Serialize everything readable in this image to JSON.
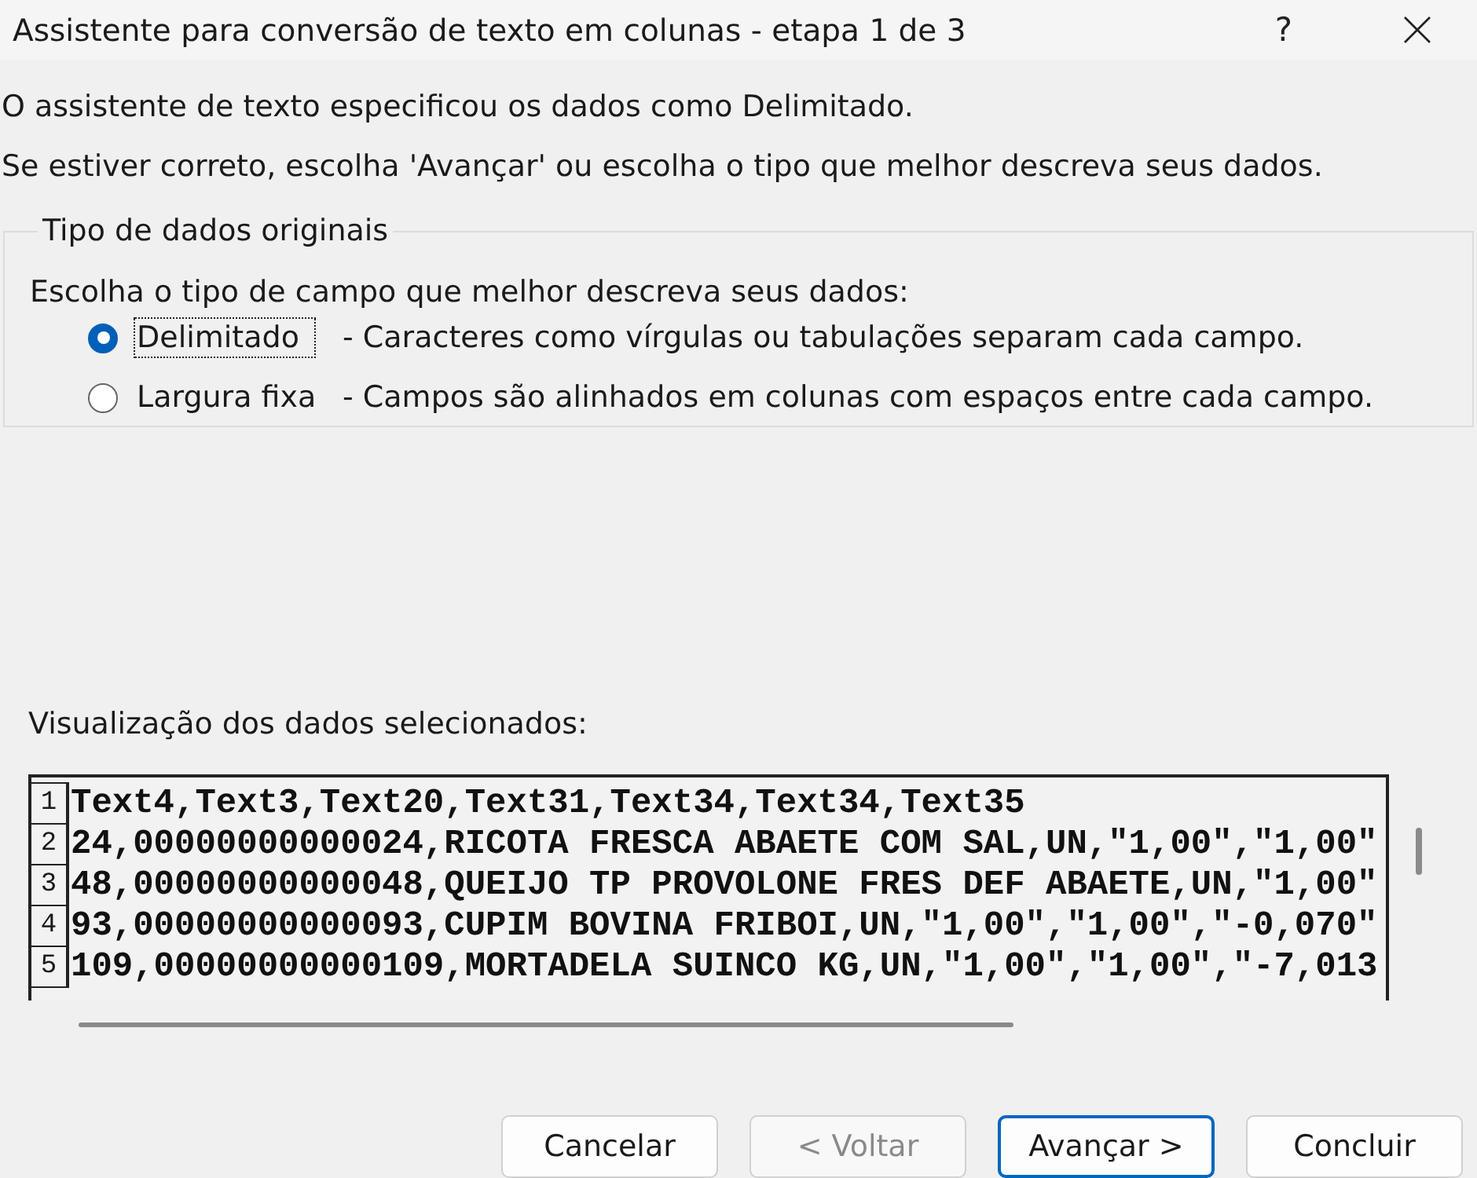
{
  "window": {
    "title": "Assistente para conversão de texto em colunas - etapa 1 de 3",
    "help_button": "?"
  },
  "intro": [
    "O assistente de texto especificou os dados como Delimitado.",
    "Se estiver correto, escolha 'Avançar' ou escolha o tipo que melhor descreva seus dados."
  ],
  "group": {
    "title": "Tipo de dados originais",
    "prompt": "Escolha o tipo de campo que melhor descreva seus dados:",
    "options": [
      {
        "label": "Delimitado",
        "description": "- Caracteres como vírgulas ou tabulações separam cada campo.",
        "selected": true,
        "focused": true
      },
      {
        "label": "Largura fixa",
        "description": "- Campos são alinhados em colunas com espaços entre cada campo.",
        "selected": false,
        "focused": false
      }
    ]
  },
  "preview": {
    "label": "Visualização dos dados selecionados:",
    "rows": [
      {
        "number": "1",
        "text": "Text4,Text3,Text20,Text31,Text34,Text34,Text35"
      },
      {
        "number": "2",
        "text": "24,00000000000024,RICOTA FRESCA ABAETE COM SAL,UN,\"1,00\",\"1,00\""
      },
      {
        "number": "3",
        "text": "48,00000000000048,QUEIJO TP PROVOLONE FRES DEF ABAETE,UN,\"1,00\""
      },
      {
        "number": "4",
        "text": "93,00000000000093,CUPIM BOVINA FRIBOI,UN,\"1,00\",\"1,00\",\"-0,070\""
      },
      {
        "number": "5",
        "text": "109,00000000000109,MORTADELA SUINCO KG,UN,\"1,00\",\"1,00\",\"-7,013"
      }
    ]
  },
  "buttons": [
    {
      "label": "Cancelar",
      "disabled": false,
      "default": false
    },
    {
      "label": "< Voltar",
      "disabled": true,
      "default": false
    },
    {
      "label": "Avançar >",
      "disabled": false,
      "default": true
    },
    {
      "label": "Concluir",
      "disabled": false,
      "default": false
    }
  ]
}
